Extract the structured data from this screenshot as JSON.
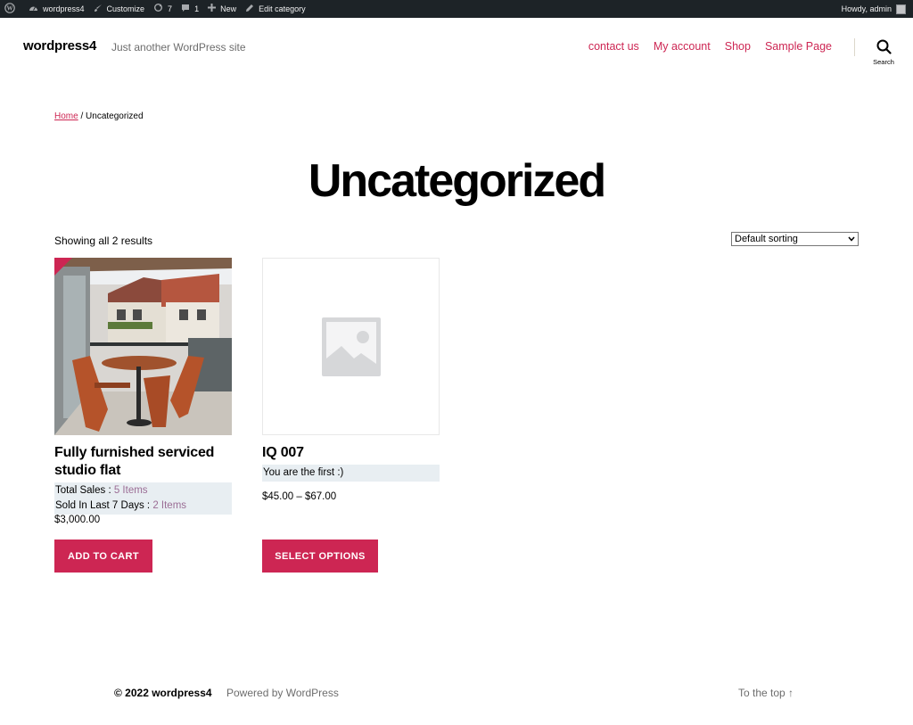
{
  "adminbar": {
    "site_name": "wordpress4",
    "customize": "Customize",
    "updates_count": "7",
    "comments_count": "1",
    "new_label": "New",
    "edit_label": "Edit category",
    "howdy": "Howdy, admin"
  },
  "header": {
    "site_title": "wordpress4",
    "description": "Just another WordPress site",
    "nav": [
      "contact us",
      "My account",
      "Shop",
      "Sample Page"
    ],
    "search_label": "Search"
  },
  "breadcrumb": {
    "home": "Home",
    "separator": " / ",
    "current": "Uncategorized"
  },
  "page": {
    "title": "Uncategorized",
    "result_count": "Showing all 2 results",
    "sort_selected": "Default sorting"
  },
  "products": [
    {
      "title": "Fully furnished serviced studio flat",
      "total_sales_label": "Total Sales : ",
      "total_sales_value": "5 Items",
      "sold_label": "Sold In Last 7 Days : ",
      "sold_value": "2 Items",
      "price": "$3,000.00",
      "button": "ADD TO CART"
    },
    {
      "title": "IQ 007",
      "note": "You are the first :)",
      "price": "$45.00 – $67.00",
      "button": "SELECT OPTIONS"
    }
  ],
  "footer": {
    "copyright": "© 2022 wordpress4",
    "powered": "Powered by WordPress",
    "to_top": "To the top ↑"
  },
  "colors": {
    "accent": "#cd2653",
    "adminbar_bg": "#1d2327",
    "info_bg": "#e8eef2",
    "highlight": "#9b6d95"
  }
}
